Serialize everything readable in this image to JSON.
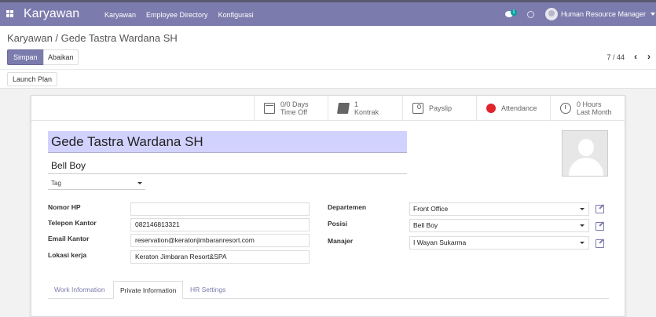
{
  "topbar": {
    "app_title": "Karyawan",
    "menu": [
      "Karyawan",
      "Employee Directory",
      "Konfigurasi"
    ],
    "chat_badge": "1",
    "user_name": "Human Resource Manager"
  },
  "breadcrumb": "Karyawan / Gede Tastra Wardana SH",
  "actions": {
    "save_label": "Simpan",
    "discard_label": "Abaikan"
  },
  "pager": {
    "counter": "7 / 44"
  },
  "statusbar": {
    "launch_label": "Launch Plan"
  },
  "smart_buttons": [
    {
      "line1": "0/0 Days",
      "line2": "Time Off",
      "icon": "calendar-icon"
    },
    {
      "line1": "1",
      "line2": "Kontrak",
      "icon": "book-icon"
    },
    {
      "line1": "Payslip",
      "line2": "",
      "icon": "money-icon"
    },
    {
      "line1": "Attendance",
      "line2": "",
      "icon": "red-circle-icon",
      "color": "#e0242b"
    },
    {
      "line1": "0 Hours",
      "line2": "Last Month",
      "icon": "clock-icon"
    }
  ],
  "employee": {
    "name": "Gede Tastra Wardana SH",
    "job_title": "Bell Boy",
    "tag_placeholder": "Tag"
  },
  "fields_left": [
    {
      "label": "Nomor HP",
      "value": ""
    },
    {
      "label": "Telepon Kantor",
      "value": "082146813321"
    },
    {
      "label": "Email Kantor",
      "value": "reservation@keratonjimbaranresort.com"
    },
    {
      "label": "Lokasi kerja",
      "value": "Keraton Jimbaran Resort&SPA"
    }
  ],
  "fields_right": [
    {
      "label": "Departemen",
      "value": "Front Office"
    },
    {
      "label": "Posisi",
      "value": "Bell Boy"
    },
    {
      "label": "Manajer",
      "value": "I Wayan Sukarma"
    }
  ],
  "tabs": [
    "Work Information",
    "Private Information",
    "HR Settings"
  ],
  "colors": {
    "brand": "#7c7bad",
    "name_highlight": "#d2d2ff",
    "attendance": "#e0242b"
  }
}
